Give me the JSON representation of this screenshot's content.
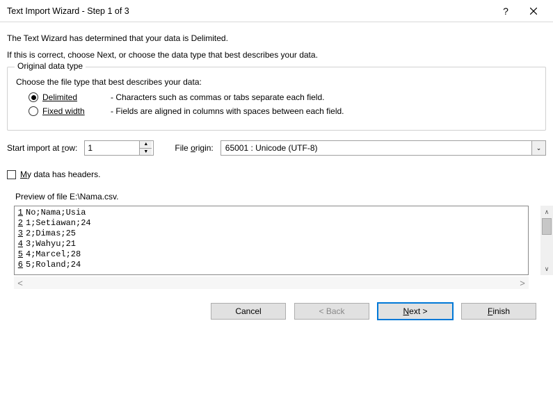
{
  "titlebar": {
    "title": "Text Import Wizard - Step 1 of 3",
    "help": "?",
    "close": "✕"
  },
  "intro": {
    "line1": "The Text Wizard has determined that your data is Delimited.",
    "line2": "If this is correct, choose Next, or choose the data type that best describes your data."
  },
  "datatype": {
    "legend": "Original data type",
    "choose": "Choose the file type that best describes your data:",
    "delimited_label": "Delimited",
    "delimited_desc": "- Characters such as commas or tabs separate each field.",
    "fixed_label": "Fixed width",
    "fixed_desc": "- Fields are aligned in columns with spaces between each field.",
    "selected": "delimited"
  },
  "startrow": {
    "label_pre": "Start import at ",
    "label_ul": "r",
    "label_post": "ow:",
    "value": "1"
  },
  "origin": {
    "label_pre": "File ",
    "label_ul": "o",
    "label_post": "rigin:",
    "value": "65001 : Unicode (UTF-8)"
  },
  "headers": {
    "label_ul": "M",
    "label_post": "y data has headers.",
    "checked": false
  },
  "preview": {
    "label": "Preview of file E:\\Nama.csv.",
    "lines": [
      {
        "n": "1",
        "t": "No;Nama;Usia"
      },
      {
        "n": "2",
        "t": "1;Setiawan;24"
      },
      {
        "n": "3",
        "t": "2;Dimas;25"
      },
      {
        "n": "4",
        "t": "3;Wahyu;21"
      },
      {
        "n": "5",
        "t": "4;Marcel;28"
      },
      {
        "n": "6",
        "t": "5;Roland;24"
      }
    ]
  },
  "buttons": {
    "cancel": "Cancel",
    "back": "< Back",
    "next_ul": "N",
    "next_post": "ext >",
    "finish_ul": "F",
    "finish_post": "inish"
  }
}
